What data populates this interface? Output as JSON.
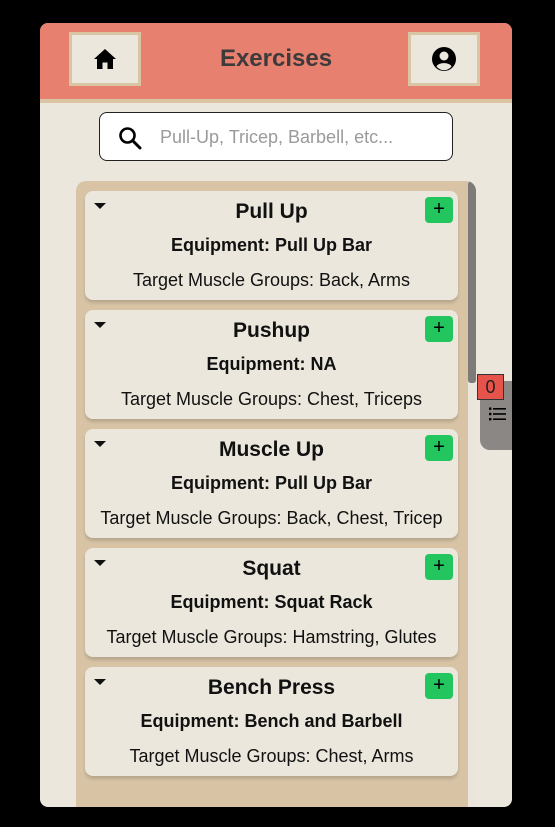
{
  "header": {
    "title": "Exercises",
    "home_icon": "home-icon",
    "profile_icon": "user-circle-icon",
    "background": "#e88070"
  },
  "search": {
    "placeholder": "Pull-Up, Tricep, Barbell, etc...",
    "value": "",
    "icon": "search-icon"
  },
  "exercises": [
    {
      "name": "Pull Up",
      "equipment": "Equipment: Pull Up Bar",
      "target": "Target Muscle Groups: Back, Arms",
      "add_label": "+"
    },
    {
      "name": "Pushup",
      "equipment": "Equipment: NA",
      "target": "Target Muscle Groups: Chest, Triceps",
      "add_label": "+"
    },
    {
      "name": "Muscle Up",
      "equipment": "Equipment: Pull Up Bar",
      "target": "Target Muscle Groups: Back, Chest, Tricep",
      "add_label": "+"
    },
    {
      "name": "Squat",
      "equipment": "Equipment: Squat Rack",
      "target": "Target Muscle Groups: Hamstring, Glutes",
      "add_label": "+"
    },
    {
      "name": "Bench Press",
      "equipment": "Equipment: Bench and Barbell",
      "target": "Target Muscle Groups: Chest, Arms",
      "add_label": "+"
    }
  ],
  "workout_drawer": {
    "count": "0",
    "icon": "list-icon",
    "badge_color": "#e5534b"
  },
  "colors": {
    "accent": "#e88070",
    "panel": "#d8c4a5",
    "add_button": "#22c55e",
    "background": "#ebe7dc"
  }
}
